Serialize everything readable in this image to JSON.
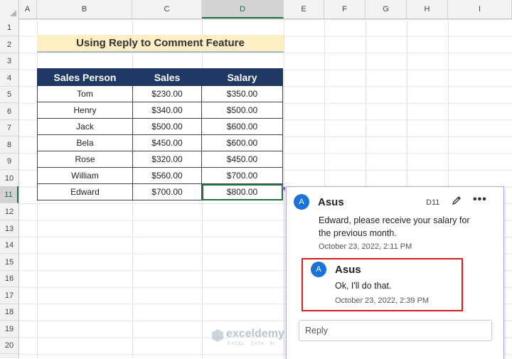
{
  "columns": [
    "A",
    "B",
    "C",
    "D",
    "E",
    "F",
    "G",
    "H",
    "I"
  ],
  "rows": [
    "1",
    "2",
    "3",
    "4",
    "5",
    "6",
    "7",
    "8",
    "9",
    "10",
    "11",
    "12",
    "13",
    "14",
    "15",
    "16",
    "17",
    "18",
    "19",
    "20"
  ],
  "title": "Using Reply to Comment Feature",
  "table": {
    "headers": [
      "Sales Person",
      "Sales",
      "Salary"
    ],
    "rows": [
      [
        "Tom",
        "$230.00",
        "$350.00"
      ],
      [
        "Henry",
        "$340.00",
        "$500.00"
      ],
      [
        "Jack",
        "$500.00",
        "$600.00"
      ],
      [
        "Bela",
        "$450.00",
        "$600.00"
      ],
      [
        "Rose",
        "$320.00",
        "$450.00"
      ],
      [
        "William",
        "$560.00",
        "$700.00"
      ],
      [
        "Edward",
        "$700.00",
        "$800.00"
      ]
    ]
  },
  "comment": {
    "avatar_letter": "A",
    "author": "Asus",
    "cell": "D11",
    "text_line1": "Edward, please receive your salary for",
    "text_line2": "the previous month.",
    "date": "October 23, 2022, 2:11 PM",
    "more": "•••"
  },
  "reply": {
    "avatar_letter": "A",
    "author": "Asus",
    "text": "Ok, I'll do that.",
    "date": "October 23, 2022, 2:39 PM"
  },
  "reply_input": {
    "placeholder": "Reply"
  },
  "watermark": {
    "brand": "exceldemy",
    "tagline": "EXCEL · DATA · BI"
  },
  "colors": {
    "header_fill": "#1f3864",
    "title_fill": "#fdeec3",
    "avatar": "#1a73d9",
    "highlight_border": "#d21f1f",
    "selection": "#217346"
  }
}
